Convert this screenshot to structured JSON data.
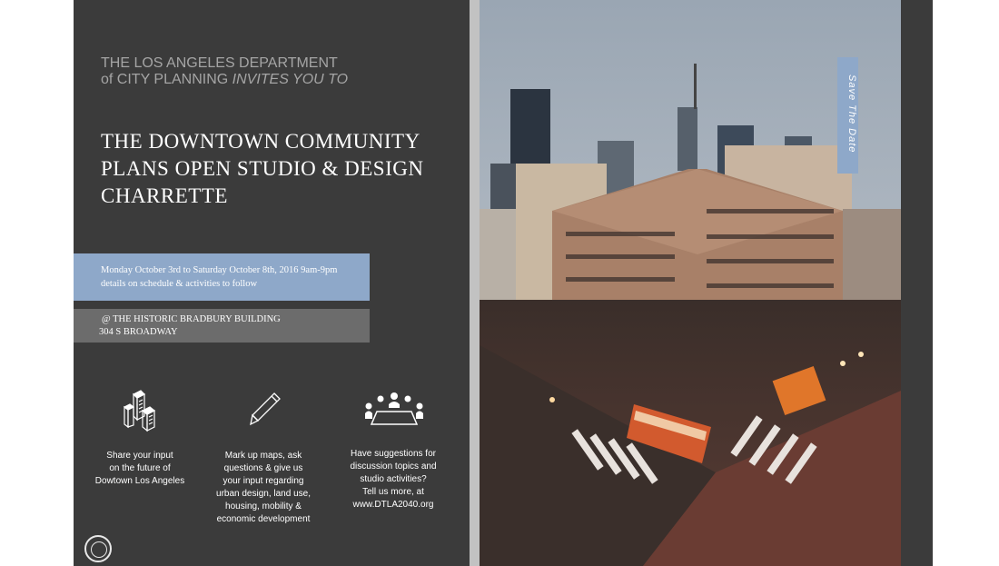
{
  "header": {
    "dept_line1": "THE LOS ANGELES DEPARTMENT",
    "dept_line2_prefix": "of CITY PLANNING ",
    "dept_line2_italic": "INVITES YOU TO"
  },
  "title_lines": [
    "THE DOWNTOWN COMMUNITY",
    "PLANS OPEN STUDIO & DESIGN",
    "CHARRETTE"
  ],
  "date": {
    "line1": "Monday October 3rd to Saturday October 8th, 2016 9am-9pm",
    "line2": "details on schedule & activities to follow"
  },
  "venue": {
    "line1": "@ THE HISTORIC BRADBURY BUILDING",
    "line2": "304 S BROADWAY"
  },
  "features": [
    {
      "icon": "buildings-icon",
      "caption": "Share your input\non the future of\nDowtown Los Angeles"
    },
    {
      "icon": "pencil-icon",
      "caption": "Mark up maps, ask\nquestions & give us\nyour input regarding\nurban design, land use,\nhousing, mobility &\neconomic development"
    },
    {
      "icon": "meeting-table-icon",
      "caption": "Have suggestions for\ndiscussion topics and\nstudio activities?\nTell us more, at\nwww.DTLA2040.org"
    }
  ],
  "save_tab": "Save The Date",
  "colors": {
    "background": "#3b3b3b",
    "accent_blue": "#8ea8c9",
    "venue_gray": "#6c6c6c",
    "dept_gray": "#a5a5a5"
  }
}
